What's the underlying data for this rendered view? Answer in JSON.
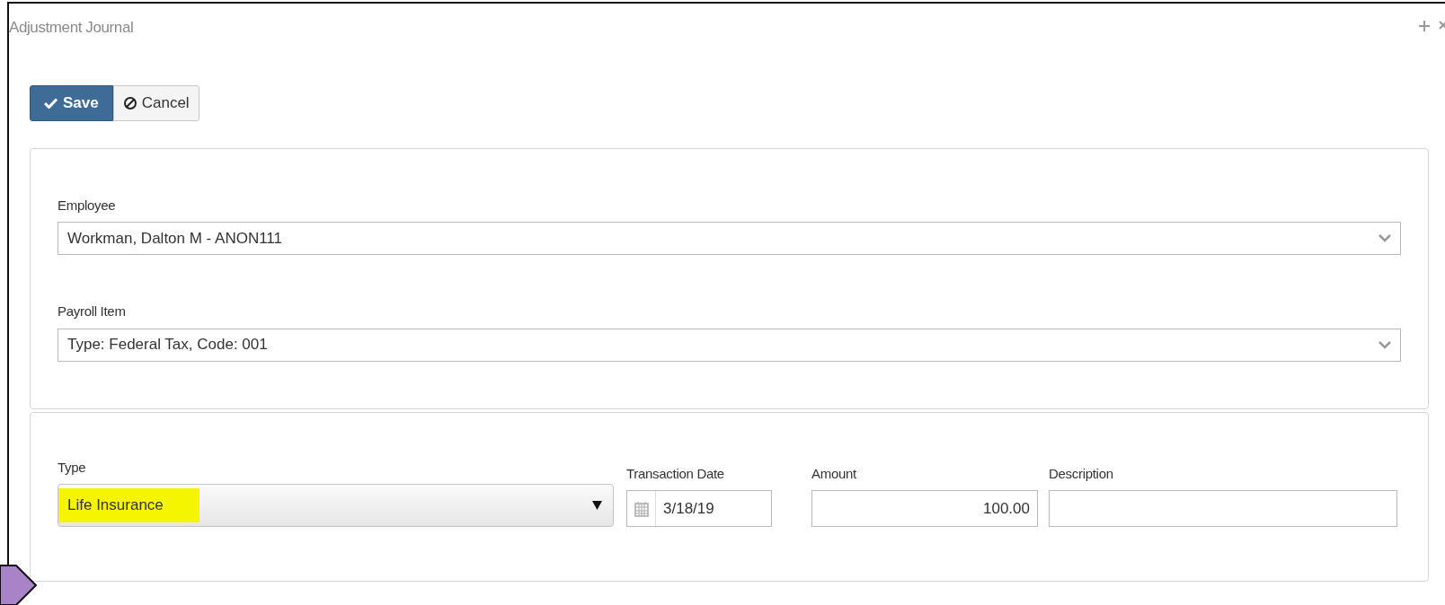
{
  "window": {
    "title": "Adjustment Journal"
  },
  "toolbar": {
    "buttons": [
      {
        "label": "Save",
        "kind": "primary"
      },
      {
        "label": "Cancel",
        "kind": "secondary"
      }
    ]
  },
  "employee_section": {
    "fields": [
      {
        "label": "Employee",
        "value": "Workman, Dalton M - ANON111"
      },
      {
        "label": "Payroll Item",
        "value": "Type: Federal Tax, Code: 001"
      }
    ]
  },
  "detail_section": {
    "type": {
      "label": "Type",
      "value": "Life Insurance",
      "highlighted": true
    },
    "transaction_date": {
      "label": "Transaction Date",
      "value": "3/18/19"
    },
    "amount": {
      "label": "Amount",
      "value": "100.00"
    },
    "description": {
      "label": "Description"
    }
  }
}
